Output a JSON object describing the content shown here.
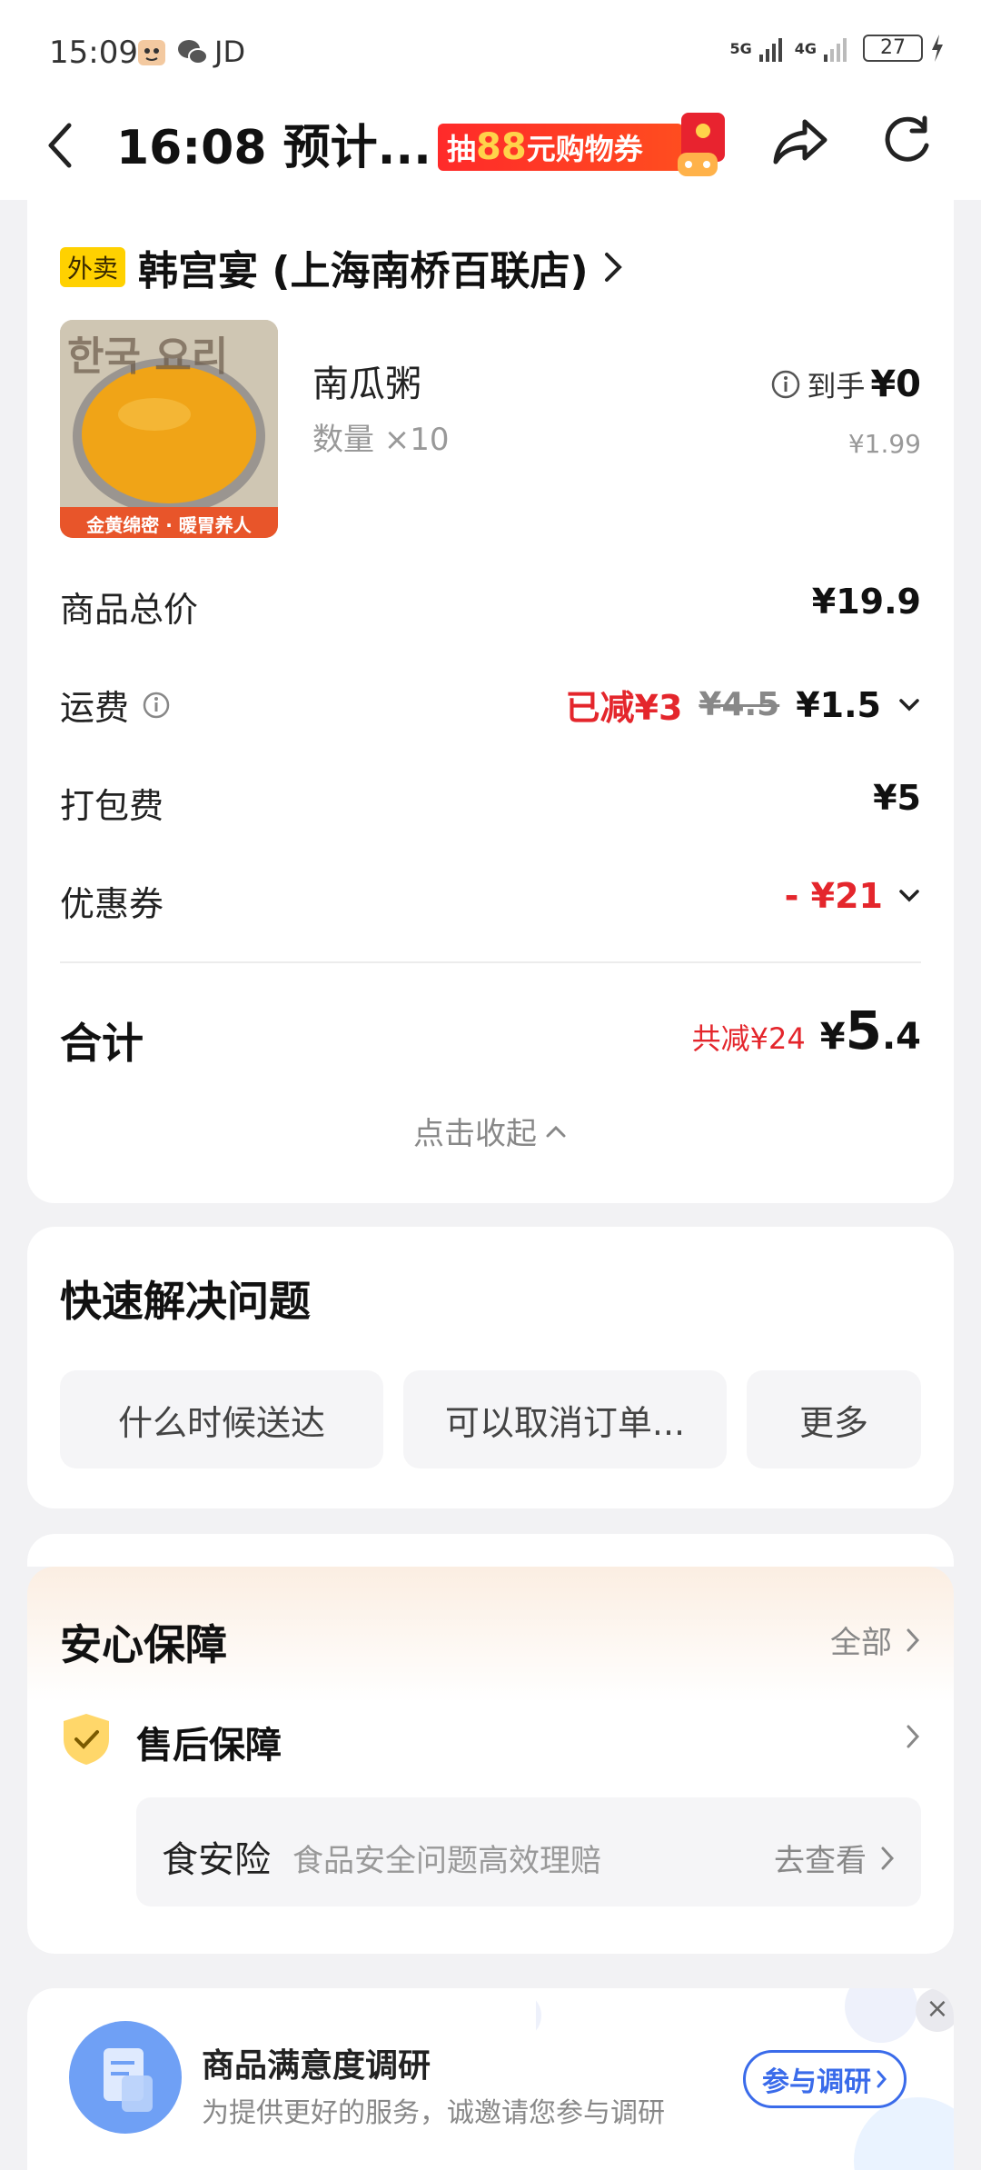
{
  "status_bar": {
    "time": "15:09",
    "app_indicator": "JD",
    "network_1": "5G",
    "network_2": "4G",
    "battery": "27"
  },
  "header": {
    "title": "16:08 预计...",
    "promo_prefix": "抽",
    "promo_number": "88",
    "promo_suffix": "元购物券"
  },
  "order": {
    "takeout_badge": "外卖",
    "store_name": "韩宫宴 (上海南桥百联店)",
    "product": {
      "image_text_top": "한국 요리",
      "image_text_bottom": "金黄绵密 · 暖胃养人",
      "name": "南瓜粥",
      "quantity": "数量 ×10",
      "final_label": "到手",
      "final_price": "¥0",
      "unit_price": "¥1.99"
    },
    "subtotal_label": "商品总价",
    "subtotal_value": "¥19.9",
    "delivery_label": "运费",
    "delivery_discount": "已减¥3",
    "delivery_original": "¥4.5",
    "delivery_fee": "¥1.5",
    "packing_label": "打包费",
    "packing_value": "¥5",
    "coupon_label": "优惠券",
    "coupon_value": "- ¥21",
    "total_label": "合计",
    "total_saved": "共减¥24",
    "total_currency": "¥",
    "total_int": "5",
    "total_dec": ".4",
    "collapse_text": "点击收起"
  },
  "quick_help": {
    "title": "快速解决问题",
    "chips": [
      "什么时候送达",
      "可以取消订单...",
      "更多"
    ]
  },
  "assurance": {
    "title": "安心保障",
    "all_link": "全部",
    "aftersale_title": "售后保障",
    "food_insurance_name": "食安险",
    "food_insurance_desc": "食品安全问题高效理赔",
    "food_insurance_link": "去查看"
  },
  "survey": {
    "title": "商品满意度调研",
    "description": "为提供更好的服务，诚邀请您参与调研",
    "button": "参与调研",
    "close": "×"
  },
  "colors": {
    "accent_red": "#e4262c",
    "badge_yellow": "#ffd100",
    "survey_blue": "#3a6bea"
  },
  "icons": [
    "back-icon",
    "gift-icon",
    "share-icon",
    "refresh-icon",
    "chevron-right-icon",
    "info-icon",
    "chevron-down-icon",
    "chevron-up-icon",
    "shield-check-icon",
    "survey-doc-icon",
    "close-icon"
  ]
}
